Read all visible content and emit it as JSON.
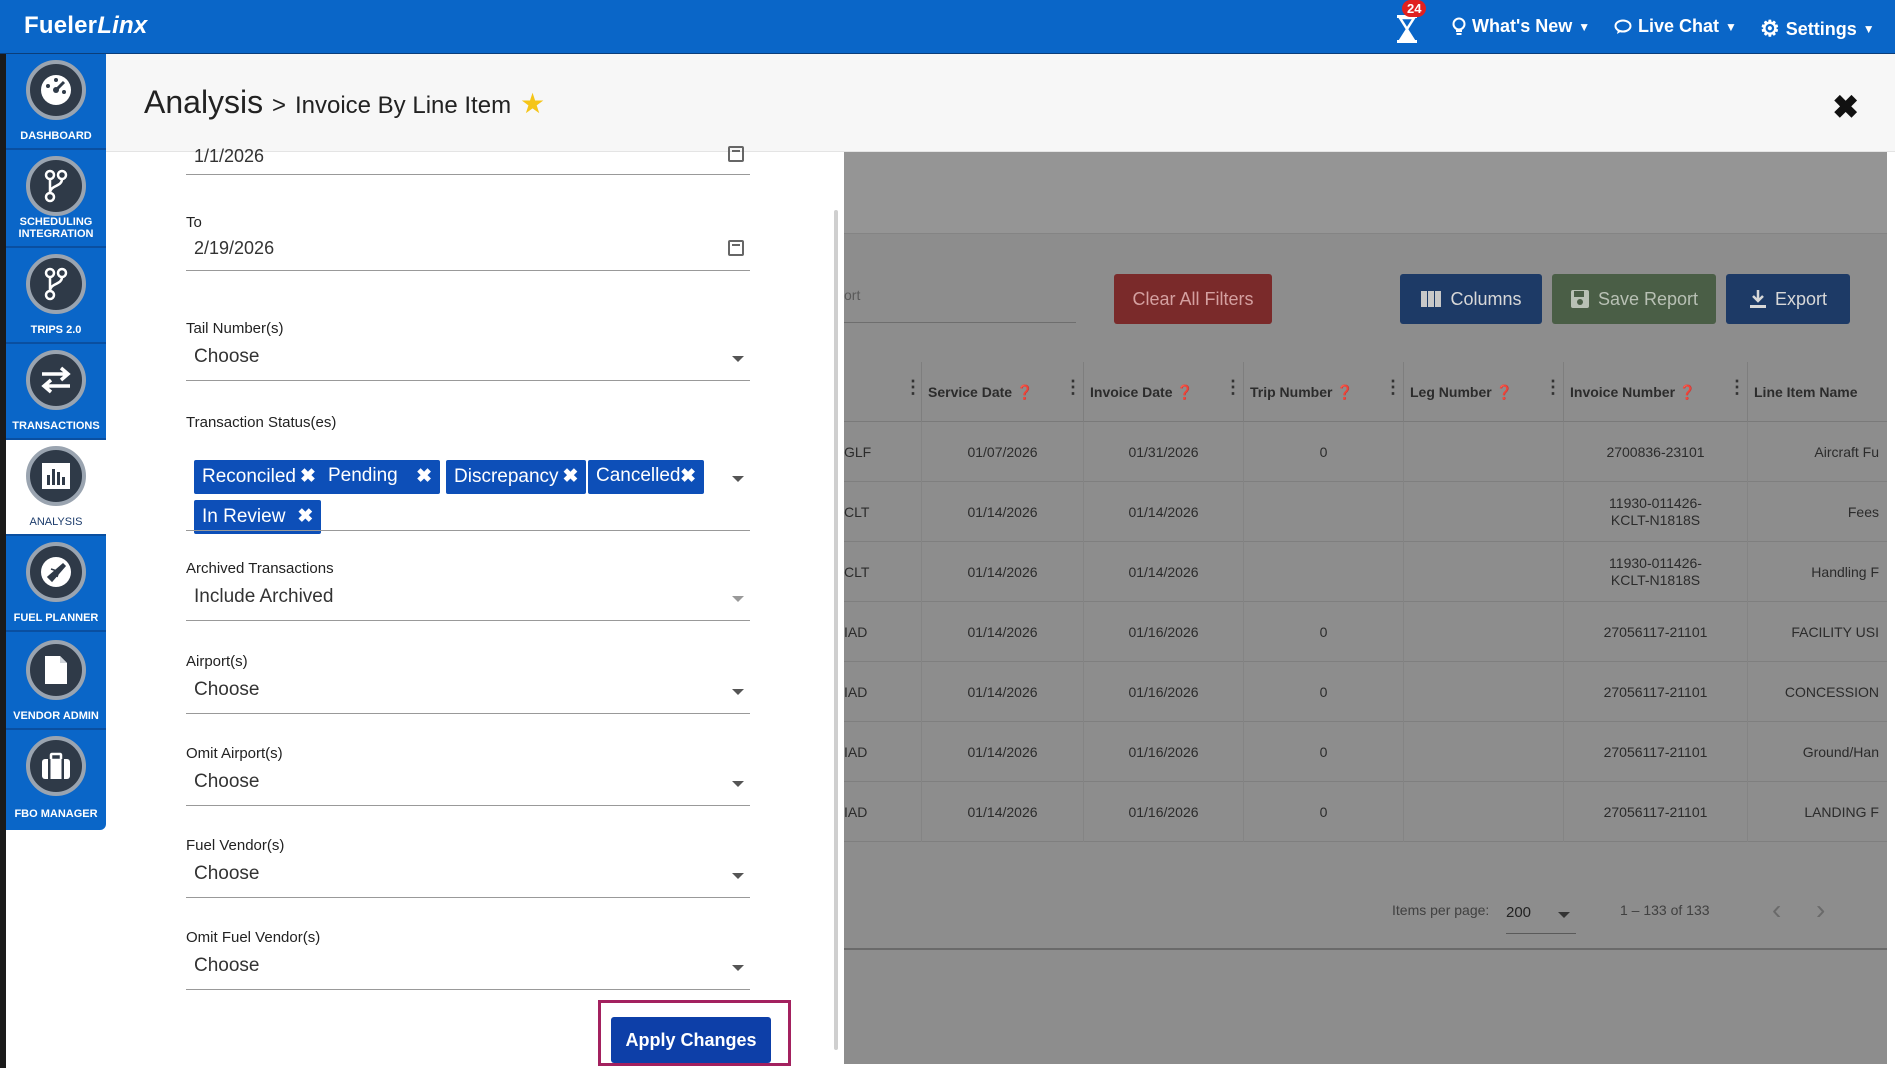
{
  "app": {
    "logo_a": "Fueler",
    "logo_b": "Linx"
  },
  "topbar": {
    "notification_count": "24",
    "whats_new": "What's New",
    "live_chat": "Live Chat",
    "settings": "Settings"
  },
  "sidebar": {
    "items": [
      {
        "label": "DASHBOARD",
        "icon": "gauge-icon"
      },
      {
        "label": "SCHEDULING INTEGRATION",
        "icon": "branch-icon"
      },
      {
        "label": "TRIPS 2.0",
        "icon": "branch-icon"
      },
      {
        "label": "TRANSACTIONS",
        "icon": "arrows-icon"
      },
      {
        "label": "ANALYSIS",
        "icon": "bar-chart-icon"
      },
      {
        "label": "FUEL PLANNER",
        "icon": "plane-icon"
      },
      {
        "label": "VENDOR ADMIN",
        "icon": "document-icon"
      },
      {
        "label": "FBO MANAGER",
        "icon": "briefcase-icon"
      }
    ]
  },
  "header": {
    "section": "Analysis",
    "separator": ">",
    "page": "Invoice By Line Item"
  },
  "filters": {
    "from_value": "1/1/2026",
    "to_label": "To",
    "to_value": "2/19/2026",
    "tail_label": "Tail Number(s)",
    "tail_value": "Choose",
    "status_label": "Transaction Status(es)",
    "status_chips": [
      "Reconciled",
      "Pending",
      "Discrepancy",
      "Cancelled",
      "In Review"
    ],
    "archived_label": "Archived Transactions",
    "archived_value": "Include Archived",
    "airports_label": "Airport(s)",
    "airports_value": "Choose",
    "omit_airports_label": "Omit Airport(s)",
    "omit_airports_value": "Choose",
    "vendors_label": "Fuel Vendor(s)",
    "vendors_value": "Choose",
    "omit_vendors_label": "Omit Fuel Vendor(s)",
    "omit_vendors_value": "Choose",
    "apply_label": "Apply Changes"
  },
  "report": {
    "search_placeholder": "ort",
    "clear_filters": "Clear All Filters",
    "columns": "Columns",
    "save_report": "Save Report",
    "export": "Export",
    "headers": [
      "Service Date",
      "Invoice Date",
      "Trip Number",
      "Leg Number",
      "Invoice Number",
      "Line Item Name"
    ],
    "rows": [
      {
        "airport": "GLF",
        "service": "01/07/2026",
        "invoice": "01/31/2026",
        "trip": "0",
        "leg": "",
        "number": "2700836-23101",
        "item": "Aircraft Fu"
      },
      {
        "airport": "CLT",
        "service": "01/14/2026",
        "invoice": "01/14/2026",
        "trip": "",
        "leg": "",
        "number": "11930-011426-KCLT-N1818S",
        "item": "Fees"
      },
      {
        "airport": "CLT",
        "service": "01/14/2026",
        "invoice": "01/14/2026",
        "trip": "",
        "leg": "",
        "number": "11930-011426-KCLT-N1818S",
        "item": "Handling F"
      },
      {
        "airport": "IAD",
        "service": "01/14/2026",
        "invoice": "01/16/2026",
        "trip": "0",
        "leg": "",
        "number": "27056117-21101",
        "item": "FACILITY USI"
      },
      {
        "airport": "IAD",
        "service": "01/14/2026",
        "invoice": "01/16/2026",
        "trip": "0",
        "leg": "",
        "number": "27056117-21101",
        "item": "CONCESSION"
      },
      {
        "airport": "IAD",
        "service": "01/14/2026",
        "invoice": "01/16/2026",
        "trip": "0",
        "leg": "",
        "number": "27056117-21101",
        "item": "Ground/Han"
      },
      {
        "airport": "IAD",
        "service": "01/14/2026",
        "invoice": "01/16/2026",
        "trip": "0",
        "leg": "",
        "number": "27056117-21101",
        "item": "LANDING F"
      }
    ],
    "items_per_page_label": "Items per page:",
    "items_per_page": "200",
    "range": "1 – 133 of 133"
  },
  "colors": {
    "brand": "#0a66c8",
    "chip": "#0d4fb8",
    "apply": "#0d3fa8",
    "highlight": "#a3215f"
  }
}
